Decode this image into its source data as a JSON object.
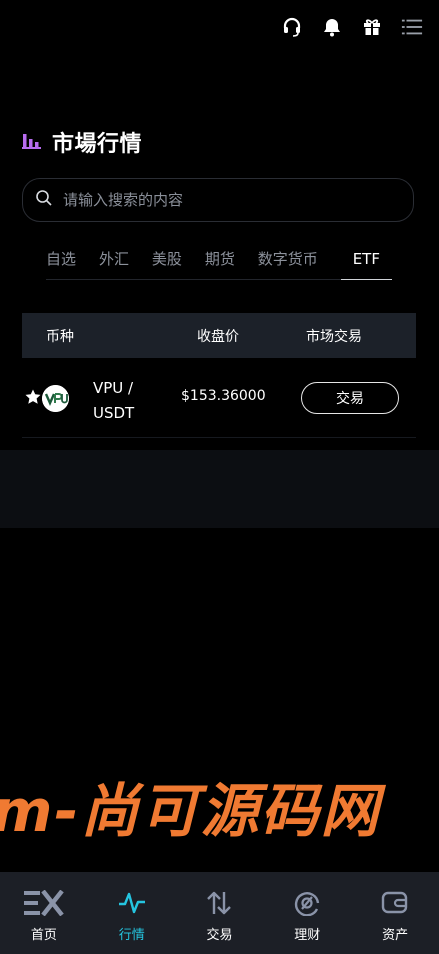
{
  "header": {
    "icons": [
      "headset-icon",
      "bell-icon",
      "gift-icon",
      "menu-icon"
    ]
  },
  "market": {
    "title": "市場行情",
    "title_icon": "bar-chart-icon"
  },
  "search": {
    "placeholder": "请输入搜索的内容"
  },
  "tabs": [
    {
      "label": "自选",
      "active": false
    },
    {
      "label": "外汇",
      "active": false
    },
    {
      "label": "美股",
      "active": false
    },
    {
      "label": "期货",
      "active": false
    },
    {
      "label": "数字货币",
      "active": false
    },
    {
      "label": "ETF",
      "active": true
    }
  ],
  "table": {
    "headers": [
      "币种",
      "收盘价",
      "市场交易"
    ],
    "rows": [
      {
        "name_line1": "VPU /",
        "name_line2": "USDT",
        "price": "$153.36000",
        "action": "交易",
        "starred": true
      }
    ]
  },
  "watermark": "m-尚可源码网",
  "bottom_nav": [
    {
      "label": "首页",
      "icon": "ex-logo-icon",
      "active": false
    },
    {
      "label": "行情",
      "icon": "pulse-icon",
      "active": true
    },
    {
      "label": "交易",
      "icon": "swap-arrows-icon",
      "active": false
    },
    {
      "label": "理财",
      "icon": "finance-icon",
      "active": false
    },
    {
      "label": "资产",
      "icon": "wallet-icon",
      "active": false
    }
  ],
  "colors": {
    "background": "#000000",
    "accent": "#25c5e0",
    "table_header_bg": "#1c2129",
    "nav_bg": "#1c1f26",
    "watermark": "#f07a32",
    "title_icon_purple": "#b86cf0"
  }
}
